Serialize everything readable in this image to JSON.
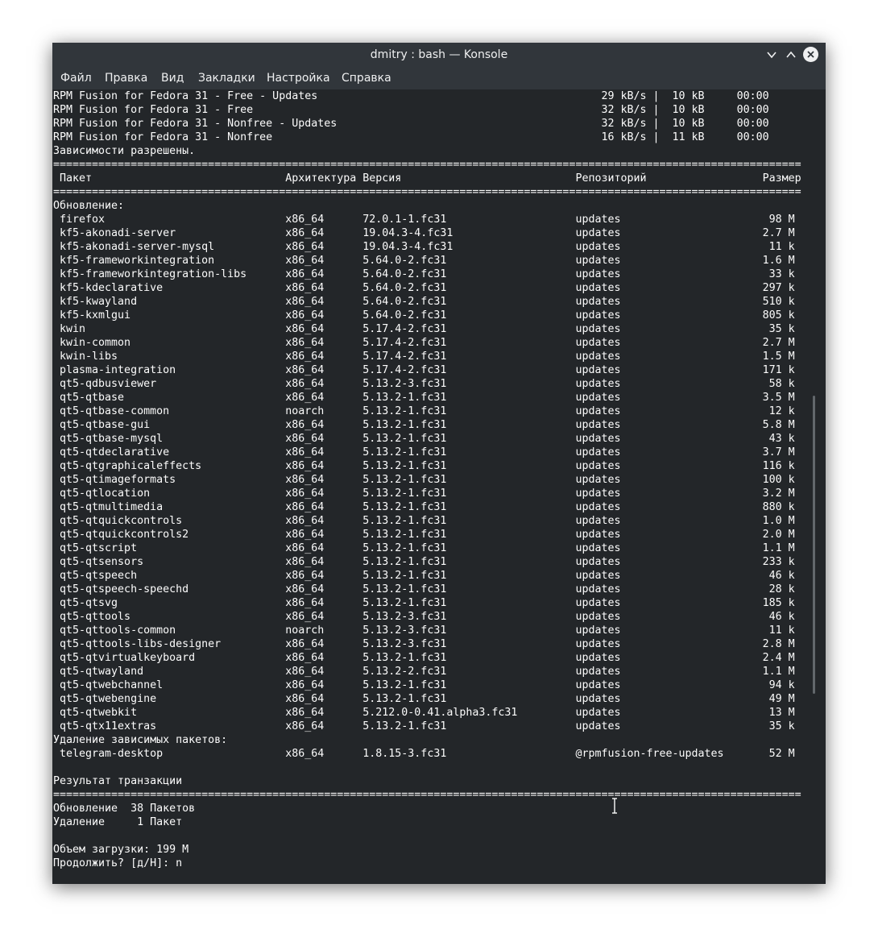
{
  "window": {
    "title": "dmitry : bash — Konsole",
    "minimize_icon": "chevron-down-icon",
    "maximize_icon": "chevron-up-icon",
    "close_icon": "close-icon"
  },
  "menu": {
    "file": "Файл",
    "edit": "Правка",
    "view": "Вид",
    "bookmarks": "Закладки",
    "settings": "Настройка",
    "help": "Справка"
  },
  "terminal": {
    "repos": [
      {
        "name": "RPM Fusion for Fedora 31 - Free - Updates",
        "speed": "29 kB/s",
        "size": "10 kB",
        "time": "00:00"
      },
      {
        "name": "RPM Fusion for Fedora 31 - Free",
        "speed": "32 kB/s",
        "size": "10 kB",
        "time": "00:00"
      },
      {
        "name": "RPM Fusion for Fedora 31 - Nonfree - Updates",
        "speed": "32 kB/s",
        "size": "10 kB",
        "time": "00:00"
      },
      {
        "name": "RPM Fusion for Fedora 31 - Nonfree",
        "speed": "16 kB/s",
        "size": "11 kB",
        "time": "00:00"
      }
    ],
    "deps_resolved": "Зависимости разрешены.",
    "headers": {
      "package": "Пакет",
      "arch": "Архитектура",
      "version": "Версия",
      "repo": "Репозиторий",
      "size": "Размер"
    },
    "upgrade_label": "Обновление:",
    "upgrade_packages": [
      {
        "name": "firefox",
        "arch": "x86_64",
        "version": "72.0.1-1.fc31",
        "repo": "updates",
        "size": "98 M"
      },
      {
        "name": "kf5-akonadi-server",
        "arch": "x86_64",
        "version": "19.04.3-4.fc31",
        "repo": "updates",
        "size": "2.7 M"
      },
      {
        "name": "kf5-akonadi-server-mysql",
        "arch": "x86_64",
        "version": "19.04.3-4.fc31",
        "repo": "updates",
        "size": "11 k"
      },
      {
        "name": "kf5-frameworkintegration",
        "arch": "x86_64",
        "version": "5.64.0-2.fc31",
        "repo": "updates",
        "size": "1.6 M"
      },
      {
        "name": "kf5-frameworkintegration-libs",
        "arch": "x86_64",
        "version": "5.64.0-2.fc31",
        "repo": "updates",
        "size": "33 k"
      },
      {
        "name": "kf5-kdeclarative",
        "arch": "x86_64",
        "version": "5.64.0-2.fc31",
        "repo": "updates",
        "size": "297 k"
      },
      {
        "name": "kf5-kwayland",
        "arch": "x86_64",
        "version": "5.64.0-2.fc31",
        "repo": "updates",
        "size": "510 k"
      },
      {
        "name": "kf5-kxmlgui",
        "arch": "x86_64",
        "version": "5.64.0-2.fc31",
        "repo": "updates",
        "size": "805 k"
      },
      {
        "name": "kwin",
        "arch": "x86_64",
        "version": "5.17.4-2.fc31",
        "repo": "updates",
        "size": "35 k"
      },
      {
        "name": "kwin-common",
        "arch": "x86_64",
        "version": "5.17.4-2.fc31",
        "repo": "updates",
        "size": "2.7 M"
      },
      {
        "name": "kwin-libs",
        "arch": "x86_64",
        "version": "5.17.4-2.fc31",
        "repo": "updates",
        "size": "1.5 M"
      },
      {
        "name": "plasma-integration",
        "arch": "x86_64",
        "version": "5.17.4-2.fc31",
        "repo": "updates",
        "size": "171 k"
      },
      {
        "name": "qt5-qdbusviewer",
        "arch": "x86_64",
        "version": "5.13.2-3.fc31",
        "repo": "updates",
        "size": "58 k"
      },
      {
        "name": "qt5-qtbase",
        "arch": "x86_64",
        "version": "5.13.2-1.fc31",
        "repo": "updates",
        "size": "3.5 M"
      },
      {
        "name": "qt5-qtbase-common",
        "arch": "noarch",
        "version": "5.13.2-1.fc31",
        "repo": "updates",
        "size": "12 k"
      },
      {
        "name": "qt5-qtbase-gui",
        "arch": "x86_64",
        "version": "5.13.2-1.fc31",
        "repo": "updates",
        "size": "5.8 M"
      },
      {
        "name": "qt5-qtbase-mysql",
        "arch": "x86_64",
        "version": "5.13.2-1.fc31",
        "repo": "updates",
        "size": "43 k"
      },
      {
        "name": "qt5-qtdeclarative",
        "arch": "x86_64",
        "version": "5.13.2-1.fc31",
        "repo": "updates",
        "size": "3.7 M"
      },
      {
        "name": "qt5-qtgraphicaleffects",
        "arch": "x86_64",
        "version": "5.13.2-1.fc31",
        "repo": "updates",
        "size": "116 k"
      },
      {
        "name": "qt5-qtimageformats",
        "arch": "x86_64",
        "version": "5.13.2-1.fc31",
        "repo": "updates",
        "size": "100 k"
      },
      {
        "name": "qt5-qtlocation",
        "arch": "x86_64",
        "version": "5.13.2-1.fc31",
        "repo": "updates",
        "size": "3.2 M"
      },
      {
        "name": "qt5-qtmultimedia",
        "arch": "x86_64",
        "version": "5.13.2-1.fc31",
        "repo": "updates",
        "size": "880 k"
      },
      {
        "name": "qt5-qtquickcontrols",
        "arch": "x86_64",
        "version": "5.13.2-1.fc31",
        "repo": "updates",
        "size": "1.0 M"
      },
      {
        "name": "qt5-qtquickcontrols2",
        "arch": "x86_64",
        "version": "5.13.2-1.fc31",
        "repo": "updates",
        "size": "2.0 M"
      },
      {
        "name": "qt5-qtscript",
        "arch": "x86_64",
        "version": "5.13.2-1.fc31",
        "repo": "updates",
        "size": "1.1 M"
      },
      {
        "name": "qt5-qtsensors",
        "arch": "x86_64",
        "version": "5.13.2-1.fc31",
        "repo": "updates",
        "size": "233 k"
      },
      {
        "name": "qt5-qtspeech",
        "arch": "x86_64",
        "version": "5.13.2-1.fc31",
        "repo": "updates",
        "size": "46 k"
      },
      {
        "name": "qt5-qtspeech-speechd",
        "arch": "x86_64",
        "version": "5.13.2-1.fc31",
        "repo": "updates",
        "size": "28 k"
      },
      {
        "name": "qt5-qtsvg",
        "arch": "x86_64",
        "version": "5.13.2-1.fc31",
        "repo": "updates",
        "size": "185 k"
      },
      {
        "name": "qt5-qttools",
        "arch": "x86_64",
        "version": "5.13.2-3.fc31",
        "repo": "updates",
        "size": "46 k"
      },
      {
        "name": "qt5-qttools-common",
        "arch": "noarch",
        "version": "5.13.2-3.fc31",
        "repo": "updates",
        "size": "11 k"
      },
      {
        "name": "qt5-qttools-libs-designer",
        "arch": "x86_64",
        "version": "5.13.2-3.fc31",
        "repo": "updates",
        "size": "2.8 M"
      },
      {
        "name": "qt5-qtvirtualkeyboard",
        "arch": "x86_64",
        "version": "5.13.2-1.fc31",
        "repo": "updates",
        "size": "2.4 M"
      },
      {
        "name": "qt5-qtwayland",
        "arch": "x86_64",
        "version": "5.13.2-2.fc31",
        "repo": "updates",
        "size": "1.1 M"
      },
      {
        "name": "qt5-qtwebchannel",
        "arch": "x86_64",
        "version": "5.13.2-1.fc31",
        "repo": "updates",
        "size": "94 k"
      },
      {
        "name": "qt5-qtwebengine",
        "arch": "x86_64",
        "version": "5.13.2-1.fc31",
        "repo": "updates",
        "size": "49 M"
      },
      {
        "name": "qt5-qtwebkit",
        "arch": "x86_64",
        "version": "5.212.0-0.41.alpha3.fc31",
        "repo": "updates",
        "size": "13 M"
      },
      {
        "name": "qt5-qtx11extras",
        "arch": "x86_64",
        "version": "5.13.2-1.fc31",
        "repo": "updates",
        "size": "35 k"
      }
    ],
    "remove_label": "Удаление зависимых пакетов:",
    "remove_packages": [
      {
        "name": "telegram-desktop",
        "arch": "x86_64",
        "version": "1.8.15-3.fc31",
        "repo": "@rpmfusion-free-updates",
        "size": "52 M"
      }
    ],
    "summary_label": "Результат транзакции",
    "summary_upgrade": "Обновление  38 Пакетов",
    "summary_remove": "Удаление     1 Пакет",
    "download_size": "Объем загрузки: 199 M",
    "prompt": "Продолжить? [д/Н]: n"
  }
}
